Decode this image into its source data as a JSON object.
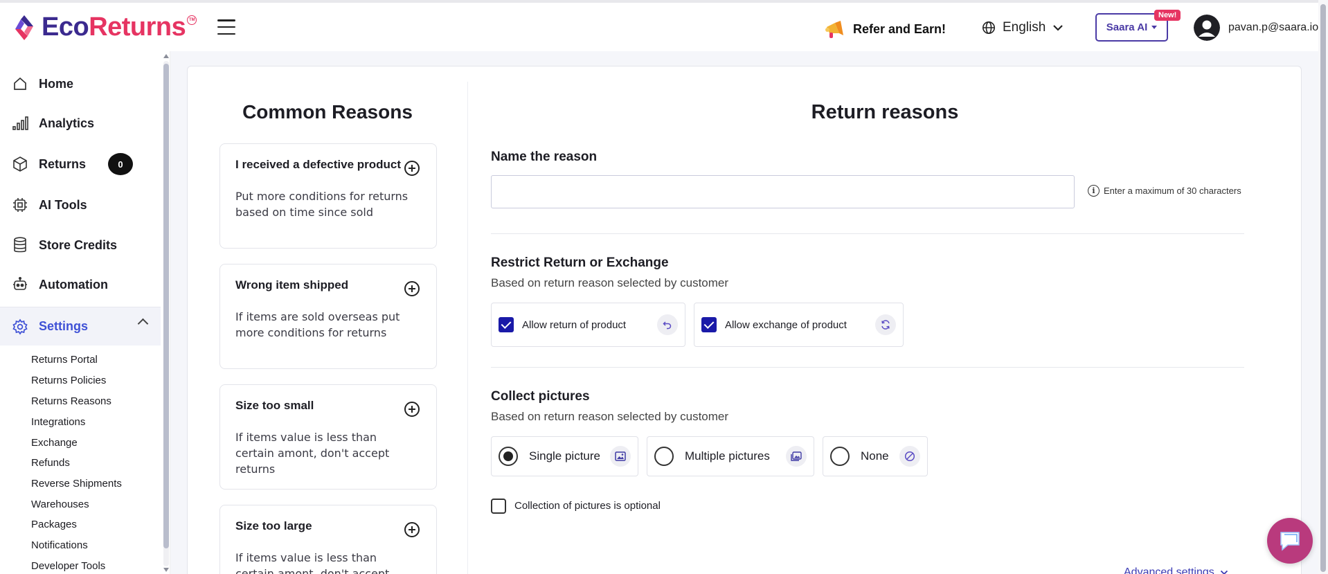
{
  "brand": {
    "eco": "Eco",
    "returns": "Returns",
    "tm": "TM"
  },
  "header": {
    "refer_label": "Refer and Earn!",
    "language": "English",
    "saara_label": "Saara AI",
    "new_badge": "New!",
    "user_email": "pavan.p@saara.io"
  },
  "sidebar": {
    "items": [
      {
        "label": "Home",
        "icon": "home-icon"
      },
      {
        "label": "Analytics",
        "icon": "analytics-icon"
      },
      {
        "label": "Returns",
        "icon": "box-icon",
        "badge": "0"
      },
      {
        "label": "AI Tools",
        "icon": "chip-icon"
      },
      {
        "label": "Store Credits",
        "icon": "database-icon"
      },
      {
        "label": "Automation",
        "icon": "robot-icon"
      }
    ],
    "settings_label": "Settings",
    "sub_items": [
      "Returns Portal",
      "Returns Policies",
      "Returns Reasons",
      "Integrations",
      "Exchange",
      "Refunds",
      "Reverse Shipments",
      "Warehouses",
      "Packages",
      "Notifications",
      "Developer Tools"
    ]
  },
  "common": {
    "title": "Common Reasons",
    "cards": [
      {
        "title": "I received a defective product",
        "desc": "Put more conditions for returns based on time since sold"
      },
      {
        "title": "Wrong item shipped",
        "desc": "If items are sold overseas put more conditions for returns"
      },
      {
        "title": "Size too small",
        "desc": "If items value is less than certain amont, don't accept returns"
      },
      {
        "title": "Size too large",
        "desc": "If items value is less than certain amont, don't accept returns"
      }
    ]
  },
  "form": {
    "title": "Return reasons",
    "name_label": "Name the reason",
    "name_value": "",
    "name_hint": "Enter a maximum of 30 characters",
    "restrict_label": "Restrict Return or Exchange",
    "restrict_sub": "Based on return reason selected by customer",
    "allow_return_label": "Allow return of product",
    "allow_exchange_label": "Allow exchange of product",
    "pictures_label": "Collect pictures",
    "pictures_sub": "Based on return reason selected by customer",
    "single_label": "Single picture",
    "multiple_label": "Multiple pictures",
    "none_label": "None",
    "selected_picture_option": "Single picture",
    "optional_label": "Collection of pictures is optional",
    "advanced_label": "Advanced settings"
  },
  "colors": {
    "brand_primary": "#3b2a8f",
    "brand_accent": "#e63462",
    "link": "#3f51d6",
    "chat": "#b93a7d"
  }
}
